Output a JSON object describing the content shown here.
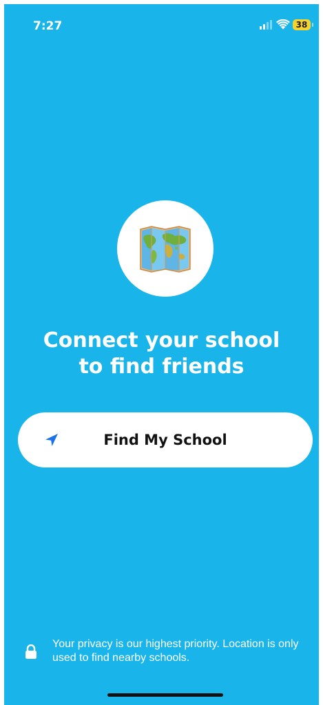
{
  "status_bar": {
    "time": "7:27",
    "battery_level": "38",
    "signal_icon": "cellular-signal-icon",
    "wifi_icon": "wifi-icon",
    "battery_color": "#F7D22C"
  },
  "hero": {
    "icon": "world-map-icon",
    "headline_line1": "Connect your school",
    "headline_line2": "to find friends"
  },
  "find_button": {
    "label": "Find My School",
    "icon": "location-arrow-icon",
    "icon_color": "#1A73E8"
  },
  "privacy": {
    "icon": "lock-icon",
    "text": "Your privacy is our highest priority. Location is only used to find nearby schools."
  },
  "theme": {
    "background": "#19B5EA",
    "text": "#FFFFFF",
    "button_background": "#FFFFFF"
  }
}
